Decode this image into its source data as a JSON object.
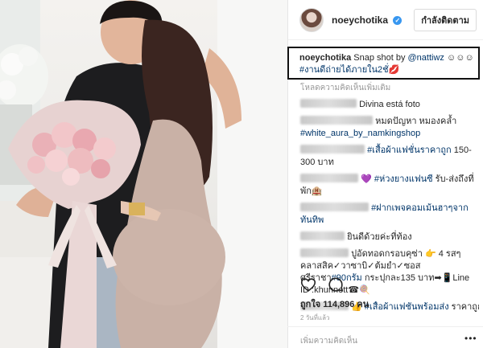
{
  "post": {
    "username": "noeychotika",
    "verified_glyph": "✓",
    "follow_label": "กำลังติดตาม",
    "caption": {
      "username": "noeychotika",
      "text": " Snap shot by ",
      "mention": "@nattiwz",
      "emoji": " ☺☺☺",
      "hashtag": "#งานดีถ่ายได้ภายใน2ชั่",
      "lips": "💋"
    }
  },
  "comments": {
    "load_more": "โหลดความคิดเห็นเพิ่มเติม",
    "items": [
      {
        "text": "Divina está foto"
      },
      {
        "text": "หมดปัญหา หมองคล้ำ",
        "tag": "#white_aura_by_namkingshop"
      },
      {
        "tag": "#เสื้อผ้าแฟชั่นราคาถูก",
        "text": "150-300 บาท"
      },
      {
        "text": "💜 ",
        "tag": "#ห่วงยางแฟนซี",
        "text2": " รับ-ส่งถึงที่พัก🏨"
      },
      {
        "tag": "#ฝากเพจคอมเม้นฮาๆจากทันทิพ"
      },
      {
        "text": "ยินดีด้วยค่ะที่ท้อง"
      },
      {
        "text": "ปูอัดทอดกรอบคุซ่า 👉 4 รสๆคลาสสิค✓วาซาบิ✓ต้มยำ✓ซอสศรีราชา",
        "tag": "#90กรัม",
        "text2": " กระปุกละ135 บาท➡📱Line ID :khunnett☎🍭"
      },
      {
        "text": "👍 ",
        "tag": "#เสื้อผ้าแฟชั่นพร้อมส่ง",
        "text2": " ราคาถูก"
      }
    ]
  },
  "actions": {
    "like_icon": "heart-outline-icon",
    "comment_icon": "comment-bubble-icon",
    "likes_text": "ถูกใจ 114,896 คน",
    "time_ago": "2 วันที่แล้ว",
    "add_comment_placeholder": "เพิ่มความคิดเห็น",
    "more_icon": "•••"
  },
  "colors": {
    "link_blue": "#003569",
    "verified_blue": "#3897f0"
  }
}
